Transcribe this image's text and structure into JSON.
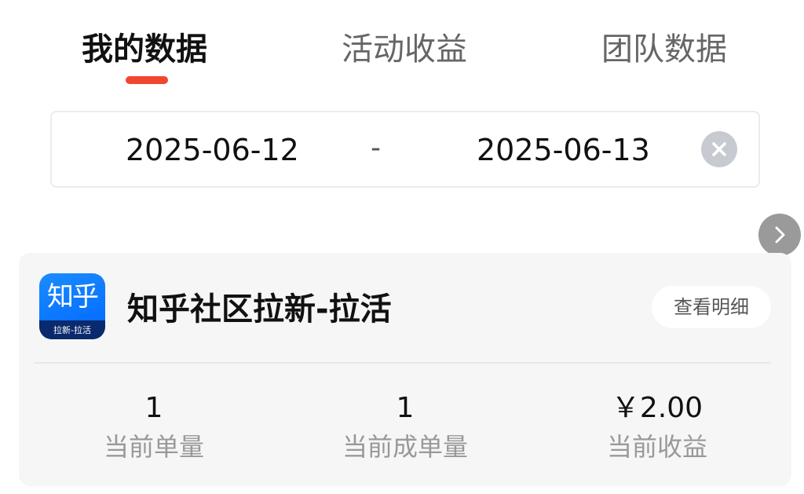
{
  "tabs": [
    {
      "label": "我的数据",
      "active": true
    },
    {
      "label": "活动收益",
      "active": false
    },
    {
      "label": "团队数据",
      "active": false
    }
  ],
  "accent_color": "#f0472e",
  "date_range": {
    "start": "2025-06-12",
    "separator": "-",
    "end": "2025-06-13",
    "clear_icon": "close-circle-icon"
  },
  "float_button": {
    "icon": "chevron-right-icon"
  },
  "card": {
    "logo": {
      "main_text": "知乎",
      "sub_text": "拉新-拉活",
      "color": "#0066ff"
    },
    "title": "知乎社区拉新-拉活",
    "detail_button": "查看明细",
    "stats": [
      {
        "value": "1",
        "label": "当前单量"
      },
      {
        "value": "1",
        "label": "当前成单量"
      },
      {
        "value": "￥2.00",
        "label": "当前收益"
      }
    ]
  }
}
